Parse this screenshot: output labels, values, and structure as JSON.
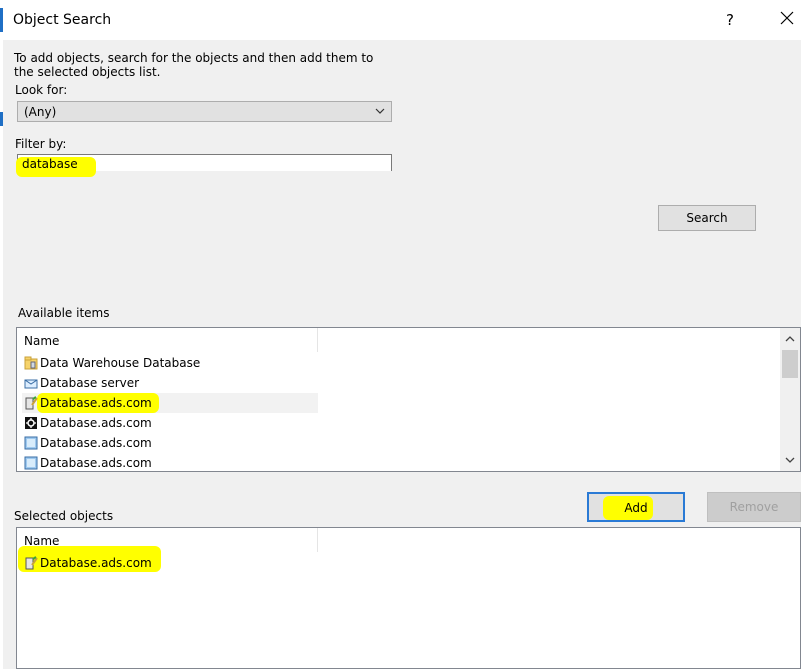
{
  "dialog": {
    "title": "Object Search",
    "help_glyph": "?",
    "instruction": "To add objects, search for the objects and then add them to the selected objects list."
  },
  "look_for": {
    "label": "Look for:",
    "selected": "(Any)"
  },
  "filter": {
    "label": "Filter by:",
    "value": "database"
  },
  "search_button": "Search",
  "available": {
    "label": "Available items",
    "column_name": "Name",
    "items": [
      {
        "icon": "folder-db-icon",
        "label": "Data Warehouse Database"
      },
      {
        "icon": "server-icon",
        "label": "Database server"
      },
      {
        "icon": "db-edit-icon",
        "label": "Database.ads.com"
      },
      {
        "icon": "gear-black-icon",
        "label": "Database.ads.com"
      },
      {
        "icon": "window-icon",
        "label": "Database.ads.com"
      },
      {
        "icon": "window-icon",
        "label": "Database.ads.com"
      }
    ]
  },
  "add_button": "Add",
  "remove_button": "Remove",
  "selected": {
    "label": "Selected objects",
    "column_name": "Name",
    "items": [
      {
        "icon": "db-edit-icon",
        "label": "Database.ads.com"
      }
    ]
  },
  "colors": {
    "highlight": "#ffff00",
    "accent": "#2a7ad5",
    "dialog_bg": "#f0f0f0"
  }
}
